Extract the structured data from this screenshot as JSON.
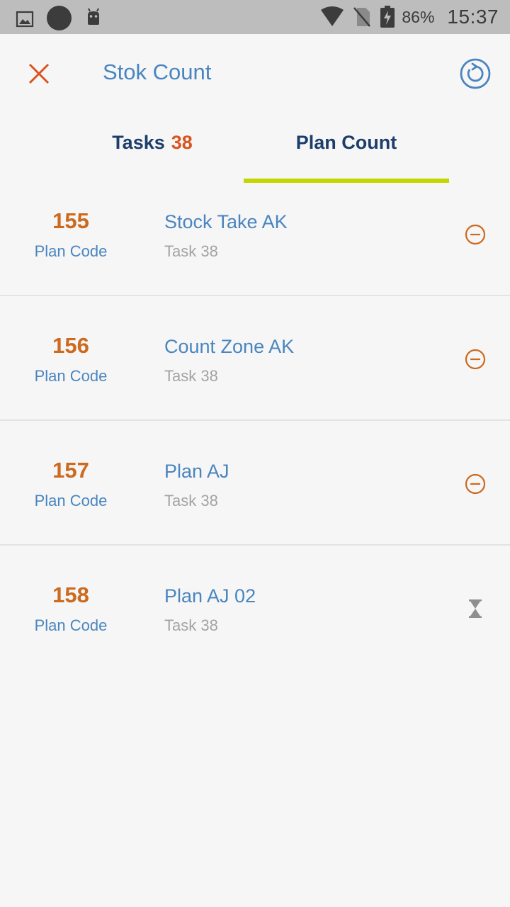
{
  "status_bar": {
    "battery_percent": "86%",
    "time": "15:37",
    "icons": [
      "image-icon",
      "circle-icon",
      "android-icon",
      "wifi-icon",
      "no-sim-icon",
      "battery-charging-icon"
    ]
  },
  "header": {
    "title": "Stok Count",
    "close_icon": "close-icon",
    "refresh_icon": "refresh-icon"
  },
  "tabs": {
    "tasks_label": "Tasks",
    "tasks_count": "38",
    "plan_label": "Plan Count",
    "active": "Plan Count",
    "accent_color": "#c4d600"
  },
  "plans": [
    {
      "code": "155",
      "code_label": "Plan Code",
      "name": "Stock Take AK",
      "task": "Task 38",
      "status_icon": "minus-circle-icon"
    },
    {
      "code": "156",
      "code_label": "Plan Code",
      "name": "Count Zone AK",
      "task": "Task 38",
      "status_icon": "minus-circle-icon"
    },
    {
      "code": "157",
      "code_label": "Plan Code",
      "name": "Plan AJ",
      "task": "Task 38",
      "status_icon": "minus-circle-icon"
    },
    {
      "code": "158",
      "code_label": "Plan Code",
      "name": "Plan AJ 02",
      "task": "Task 38",
      "status_icon": "hourglass-icon"
    }
  ],
  "colors": {
    "code_orange": "#cc6a1f",
    "link_blue": "#4a85bf",
    "tab_navy": "#1d3d6b",
    "count_red": "#d9541e"
  }
}
